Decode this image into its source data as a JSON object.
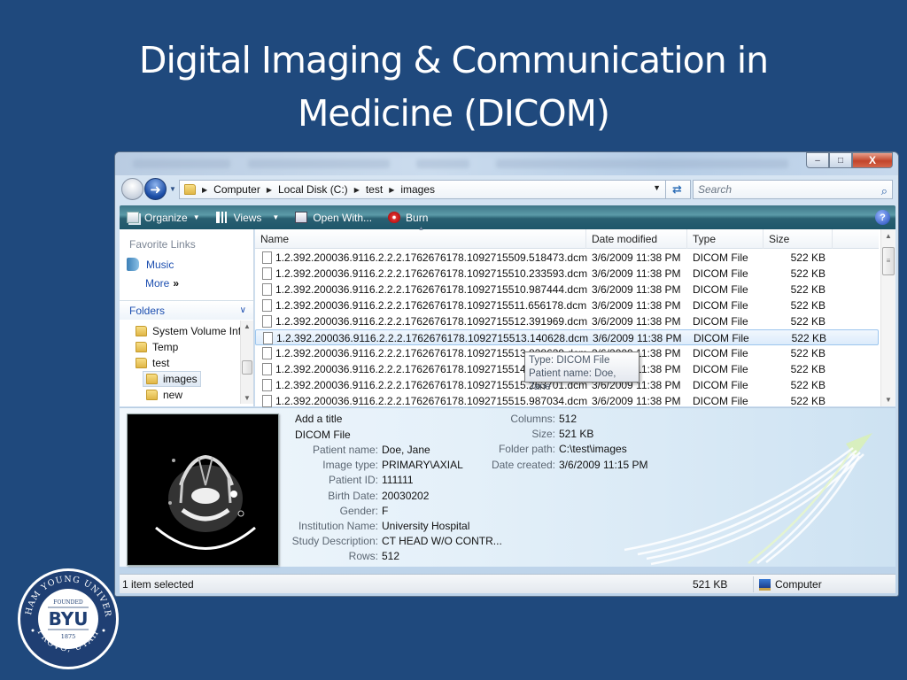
{
  "slide": {
    "title_line1": "Digital Imaging & Communication in",
    "title_line2": "Medicine (DICOM)"
  },
  "window": {
    "controls": {
      "minimize": "–",
      "maximize": "□",
      "close": "X"
    },
    "address": {
      "crumbs": [
        "Computer",
        "Local Disk (C:)",
        "test",
        "images"
      ],
      "separator": "▶",
      "dropdown": "▼",
      "refresh_icon": "⇄"
    },
    "search": {
      "placeholder": "Search",
      "icon": "⌕"
    },
    "toolbar": {
      "organize": "Organize",
      "views": "Views",
      "open_with": "Open With...",
      "burn": "Burn",
      "caret": "▼",
      "help": "?"
    },
    "nav_pane": {
      "favorite_links_title": "Favorite Links",
      "music": "Music",
      "more": "More",
      "more_chevron": "»",
      "folders_title": "Folders",
      "folders_chevron": "∨",
      "tree": [
        {
          "label": "System Volume Inf",
          "level": 1,
          "selected": false
        },
        {
          "label": "Temp",
          "level": 1,
          "selected": false
        },
        {
          "label": "test",
          "level": 1,
          "selected": false
        },
        {
          "label": "images",
          "level": 2,
          "selected": true
        },
        {
          "label": "new",
          "level": 2,
          "selected": false
        }
      ]
    },
    "file_list": {
      "columns": {
        "name": "Name",
        "date": "Date modified",
        "type": "Type",
        "size": "Size"
      },
      "rows": [
        {
          "name": "1.2.392.200036.9116.2.2.2.1762676178.1092715509.518473.dcm",
          "date": "3/6/2009 11:38 PM",
          "type": "DICOM File",
          "size": "522 KB",
          "selected": false
        },
        {
          "name": "1.2.392.200036.9116.2.2.2.1762676178.1092715510.233593.dcm",
          "date": "3/6/2009 11:38 PM",
          "type": "DICOM File",
          "size": "522 KB",
          "selected": false
        },
        {
          "name": "1.2.392.200036.9116.2.2.2.1762676178.1092715510.987444.dcm",
          "date": "3/6/2009 11:38 PM",
          "type": "DICOM File",
          "size": "522 KB",
          "selected": false
        },
        {
          "name": "1.2.392.200036.9116.2.2.2.1762676178.1092715511.656178.dcm",
          "date": "3/6/2009 11:38 PM",
          "type": "DICOM File",
          "size": "522 KB",
          "selected": false
        },
        {
          "name": "1.2.392.200036.9116.2.2.2.1762676178.1092715512.391969.dcm",
          "date": "3/6/2009 11:38 PM",
          "type": "DICOM File",
          "size": "522 KB",
          "selected": false
        },
        {
          "name": "1.2.392.200036.9116.2.2.2.1762676178.1092715513.140628.dcm",
          "date": "3/6/2009 11:38 PM",
          "type": "DICOM File",
          "size": "522 KB",
          "selected": true
        },
        {
          "name": "1.2.392.200036.9116.2.2.2.1762676178.1092715513.838639.dcm",
          "date": "3/6/2009 11:38 PM",
          "type": "DICOM File",
          "size": "522 KB",
          "selected": false
        },
        {
          "name": "1.2.392.200036.9116.2.2.2.1762676178.1092715514.548692.dcm",
          "date": "3/6/2009 11:38 PM",
          "type": "DICOM File",
          "size": "522 KB",
          "selected": false
        },
        {
          "name": "1.2.392.200036.9116.2.2.2.1762676178.1092715515.263701.dcm",
          "date": "3/6/2009 11:38 PM",
          "type": "DICOM File",
          "size": "522 KB",
          "selected": false
        },
        {
          "name": "1.2.392.200036.9116.2.2.2.1762676178.1092715515.987034.dcm",
          "date": "3/6/2009 11:38 PM",
          "type": "DICOM File",
          "size": "522 KB",
          "selected": false
        }
      ]
    },
    "tooltip": {
      "line1": "Type: DICOM File",
      "line2": "Patient name: Doe, Jane"
    },
    "details": {
      "title": "Add a title",
      "file_type": "DICOM File",
      "left_fields": [
        {
          "key": "Patient name:",
          "value": "Doe, Jane"
        },
        {
          "key": "Image type:",
          "value": "PRIMARY\\AXIAL"
        },
        {
          "key": "Patient ID:",
          "value": "111111"
        },
        {
          "key": "Birth Date:",
          "value": "20030202"
        },
        {
          "key": "Gender:",
          "value": "F"
        },
        {
          "key": "Institution Name:",
          "value": "University Hospital"
        },
        {
          "key": "Study Description:",
          "value": "CT HEAD W/O CONTR..."
        },
        {
          "key": "Rows:",
          "value": "512"
        }
      ],
      "right_fields": [
        {
          "key": "Columns:",
          "value": "512"
        },
        {
          "key": "Size:",
          "value": "521 KB"
        },
        {
          "key": "Folder path:",
          "value": "C:\\test\\images"
        },
        {
          "key": "Date created:",
          "value": "3/6/2009 11:15 PM"
        }
      ]
    },
    "status_bar": {
      "selection": "1 item selected",
      "size": "521 KB",
      "location": "Computer"
    }
  },
  "logo": {
    "top_text": "BRIGHAM YOUNG UNIVERSITY",
    "bottom_text": "PROVO, UTAH",
    "founded": "FOUNDED",
    "name": "BYU",
    "year": "1875"
  },
  "colors": {
    "slide_bg": "#1f497d",
    "toolbar": "#2a6072",
    "link_blue": "#1d4fb0",
    "close_red": "#c2452b"
  }
}
